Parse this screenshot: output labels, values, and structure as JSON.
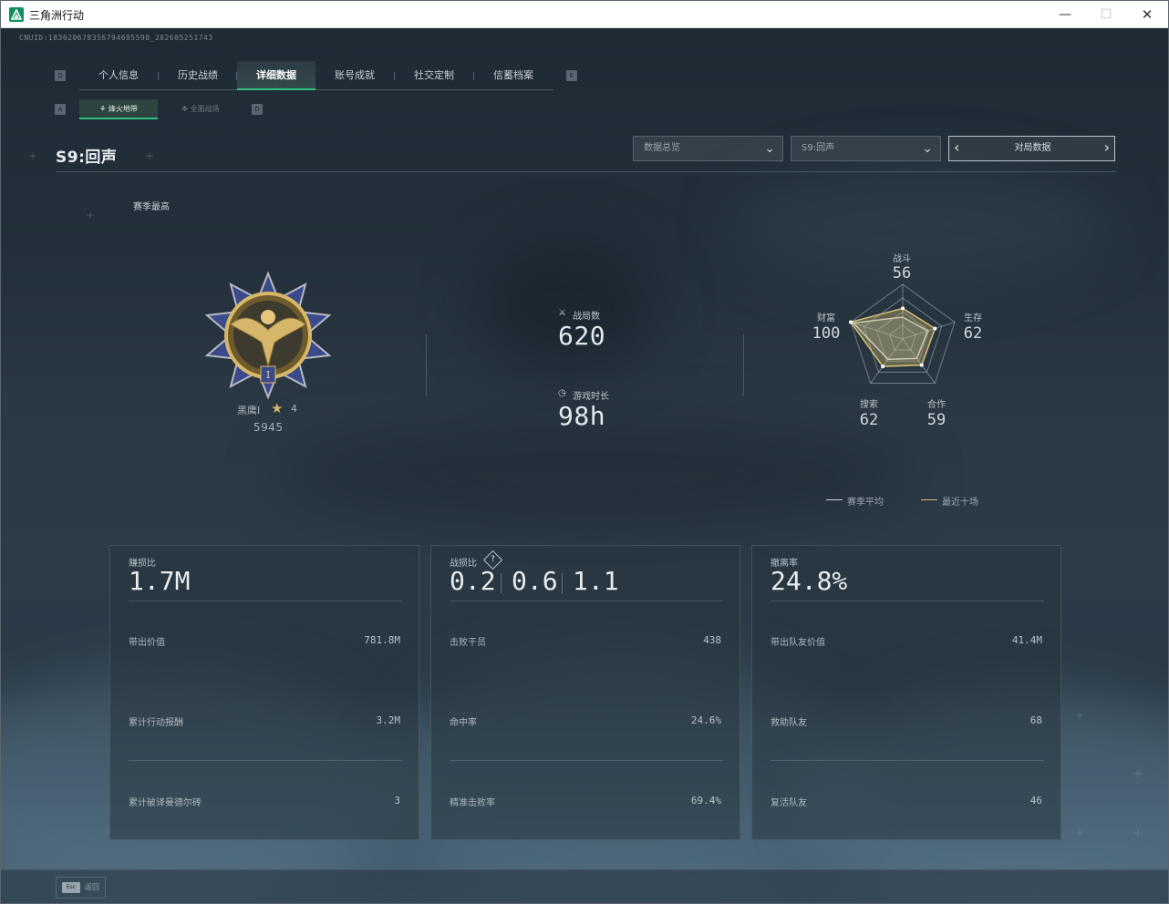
{
  "window": {
    "title": "三角洲行动"
  },
  "cnuid": "CNUID:18302067835679469559​8_202605251743",
  "tabs": {
    "left_key": "Q",
    "right_key": "E",
    "items": [
      "个人信息",
      "历史战绩",
      "详细数据",
      "账号成就",
      "社交定制",
      "信蓄档案"
    ],
    "active": "详细数据"
  },
  "subtabs": {
    "left_key": "A",
    "right_key": "D",
    "items": [
      "烽火地带",
      "全面战场"
    ],
    "active": "烽火地带"
  },
  "header": {
    "season_title": "S9:回声",
    "dropdown_overview": "数据总览",
    "dropdown_season": "S9:回声",
    "mode_label": "对局数据"
  },
  "rank": {
    "section_label": "赛季最高",
    "name": "黑鹰I",
    "stars": "4",
    "score": "5945",
    "badge_numeral": "I"
  },
  "stats": {
    "matches_label": "战局数",
    "matches_value": "620",
    "playtime_label": "游戏时长",
    "playtime_value": "98h"
  },
  "radar": {
    "axes": [
      {
        "label": "战斗",
        "value": "56"
      },
      {
        "label": "生存",
        "value": "62"
      },
      {
        "label": "合作",
        "value": "59"
      },
      {
        "label": "搜索",
        "value": "62"
      },
      {
        "label": "财富",
        "value": "100"
      }
    ],
    "legend": {
      "season_avg": "赛季平均",
      "recent_ten": "最近十场"
    },
    "colors": {
      "season_avg": "#c9d0d6",
      "recent_ten": "#d8c070"
    },
    "season_avg_values": [
      40,
      48,
      44,
      46,
      95
    ],
    "recent_ten_values": [
      56,
      62,
      59,
      62,
      100
    ]
  },
  "cards": [
    {
      "title": "赚损比",
      "value": "1.7M",
      "rows": [
        {
          "label": "带出价值",
          "value": "781.8M"
        },
        {
          "label": "累计行动报酬",
          "value": "3.2M"
        },
        {
          "label": "累计破译曼德尔砖",
          "value": "3"
        }
      ]
    },
    {
      "title": "战损比",
      "kd_values": [
        "0.2",
        "0.6",
        "1.1"
      ],
      "help": "?",
      "rows": [
        {
          "label": "击败干员",
          "value": "438"
        },
        {
          "label": "命中率",
          "value": "24.6%"
        },
        {
          "label": "精准击败率",
          "value": "69.4%"
        }
      ]
    },
    {
      "title": "撤离率",
      "value": "24.8%",
      "rows": [
        {
          "label": "带出队友价值",
          "value": "41.4M"
        },
        {
          "label": "救助队友",
          "value": "68"
        },
        {
          "label": "复活队友",
          "value": "46"
        }
      ]
    }
  ],
  "footer": {
    "esc_key": "Esc",
    "back_label": "返回"
  }
}
